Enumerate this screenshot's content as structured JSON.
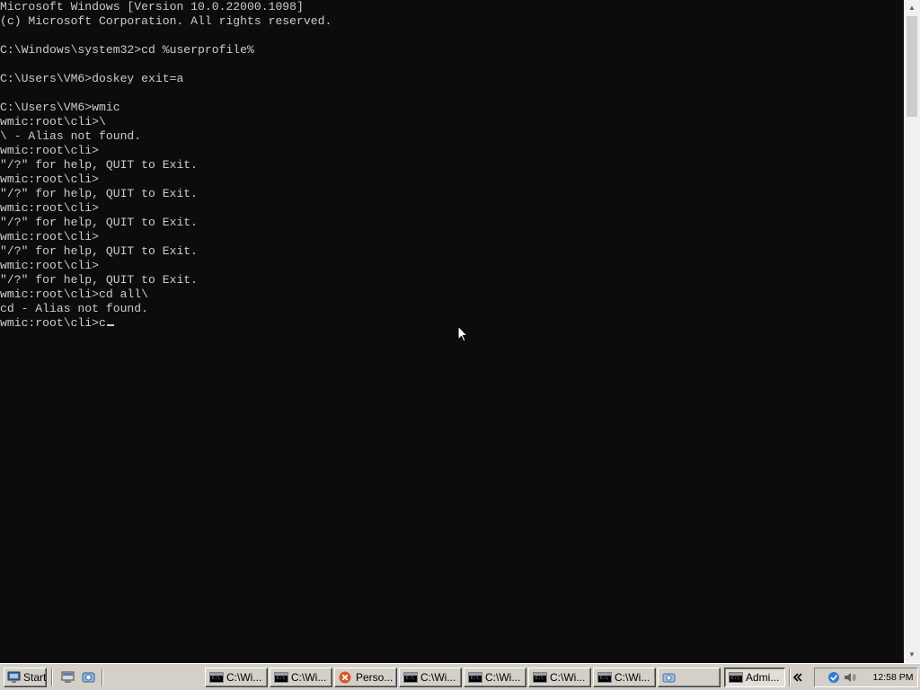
{
  "console": {
    "lines": [
      "Microsoft Windows [Version 10.0.22000.1098]",
      "(c) Microsoft Corporation. All rights reserved.",
      "",
      "C:\\Windows\\system32>cd %userprofile%",
      "",
      "C:\\Users\\VM6>doskey exit=a",
      "",
      "C:\\Users\\VM6>wmic",
      "wmic:root\\cli>\\",
      "\\ - Alias not found.",
      "wmic:root\\cli>",
      "\"/?\" for help, QUIT to Exit.",
      "wmic:root\\cli>",
      "\"/?\" for help, QUIT to Exit.",
      "wmic:root\\cli>",
      "\"/?\" for help, QUIT to Exit.",
      "wmic:root\\cli>",
      "\"/?\" for help, QUIT to Exit.",
      "wmic:root\\cli>",
      "\"/?\" for help, QUIT to Exit.",
      "wmic:root\\cli>cd all\\",
      "cd - Alias not found.",
      "wmic:root\\cli>c"
    ],
    "text_color": "#cccccc",
    "background": "#0c0c0c"
  },
  "taskbar": {
    "start_label": "Start",
    "buttons": [
      {
        "label": "C:\\Wi...",
        "icon": "cmd-icon"
      },
      {
        "label": "C:\\Wi...",
        "icon": "cmd-icon"
      },
      {
        "label": "Perso...",
        "icon": "close-circle-icon"
      },
      {
        "label": "C:\\Wi...",
        "icon": "cmd-icon"
      },
      {
        "label": "C:\\Wi...",
        "icon": "cmd-icon"
      },
      {
        "label": "C:\\Wi...",
        "icon": "cmd-icon"
      },
      {
        "label": "C:\\Wi...",
        "icon": "cmd-icon"
      },
      {
        "label": "",
        "icon": "camera-icon"
      },
      {
        "label": "Admi...",
        "icon": "cmd-icon",
        "active": true
      }
    ],
    "clock": "12:58 PM",
    "quicklaunch_icons": [
      "show-desktop-icon",
      "screenshot-icon"
    ],
    "tray_icons": [
      "expand-tray-icon",
      "network-shield-icon",
      "volume-icon"
    ]
  }
}
